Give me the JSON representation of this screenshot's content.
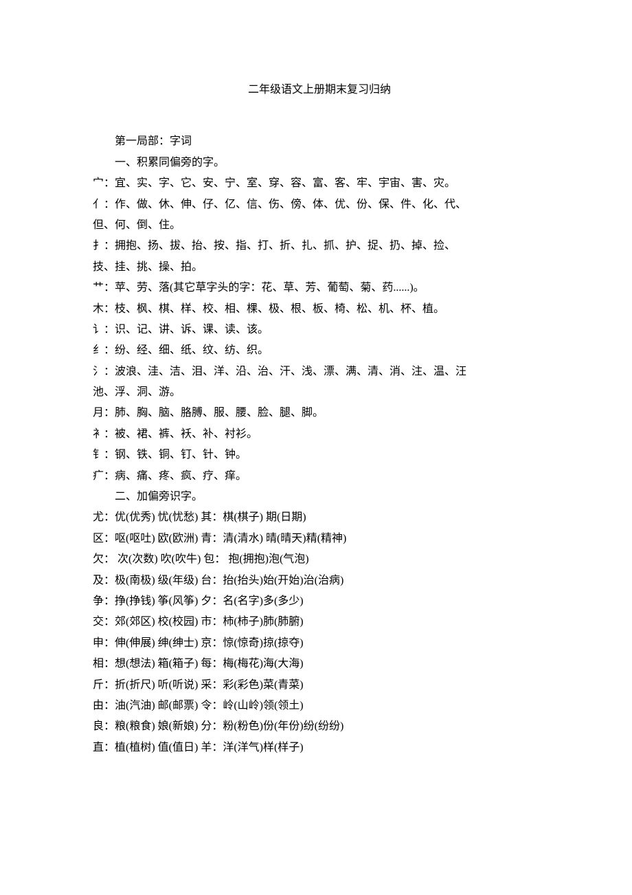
{
  "title": "二年级语文上册期末复习归纳",
  "section1_header": "第一局部：字词",
  "section1_sub1": "一、积累同偏旁的字。",
  "lines1": [
    "宀：宜、实、字、它、安、宁、室、穿、容、富、客、牢、宇宙、害、灾。",
    "亻：作、做、休、伸、仔、亿、信、伤、傍、体、优、份、保、件、化、代、",
    "但、何、倒、住。",
    "扌：拥抱、扬、拔、抬、按、指、打、折、扎、抓、护、捉、扔、掉、捡、",
    "技、挂、挑、操、拍。",
    "艹：苹、劳、落(其它草字头的字：花、草、芳、葡萄、菊、药......)。",
    "木：枝、枫、棋、样、校、相、棵、极、根、板、椅、松、机、杯、植。",
    "讠：识、记、讲、诉、课、读、该。",
    "纟：纷、经、细、纸、纹、纺、织。",
    "氵：波浪、洼、洁、泪、洋、沿、治、汗、浅、漂、满、清、消、注、温、汪",
    "池、浮、洞、游。",
    "月：肺、胸、脑、胳膊、服、腰、脸、腿、脚。",
    "衤：被、裙、裤、袄、补、衬衫。",
    "钅：钢、铁、铜、钉、针、钟。",
    "疒：病、痛、疼、疯、疗、痒。"
  ],
  "section1_sub2": "二、加偏旁识字。",
  "lines2": [
    "尤：优(优秀)  忧(忧愁)  其：棋(棋子)  期(日期)",
    "区：呕(呕吐)  欧(欧洲)  青：清(清水)  晴(晴天)精(精神)",
    "欠：  次(次数)  吹(吹牛)  包：  抱(拥抱)泡(气泡)",
    "及：极(南极)  级(年级)  台：抬(抬头)始(开始)治(治病)",
    "争：挣(挣钱)  筝(风筝)  夕：名(名字)多(多少)",
    "交：郊(郊区)  校(校园)  市：柿(柿子)肺(肺腑)",
    "申：伸(伸展)  绅(绅士)  京：惊(惊奇)掠(掠夺)",
    "相：想(想法)  箱(箱子)  每：梅(梅花)海(大海)",
    "斤：折(折尺)  听(听说)  采：彩(彩色)菜(青菜)",
    "由：油(汽油)  邮(邮票)  令：岭(山岭)领(领土)",
    "良：粮(粮食)  娘(新娘)  分：粉(粉色)份(年份)纷(纷纷)",
    "直：植(植树)  值(值日)  羊：洋(洋气)样(样子)"
  ]
}
